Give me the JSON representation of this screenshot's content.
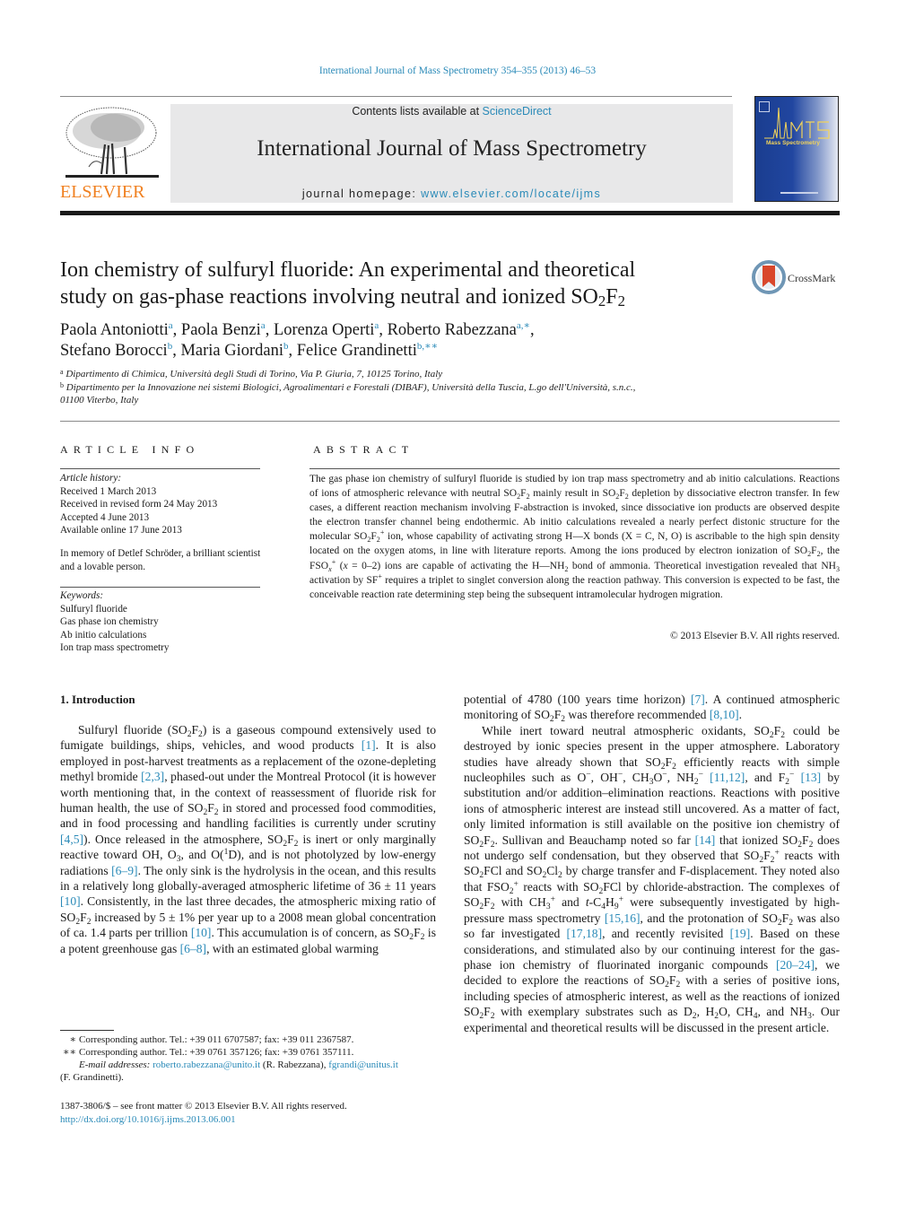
{
  "running_header": "International Journal of Mass Spectrometry 354–355 (2013) 46–53",
  "masthead": {
    "publisher_logo_text": "ELSEVIER",
    "contents_prefix": "Contents lists available at ",
    "contents_link": "ScienceDirect",
    "journal_title": "International Journal of Mass Spectrometry",
    "homepage_prefix": "journal homepage: ",
    "homepage_link": "www.elsevier.com/locate/ijms",
    "cover_title": "Mass Spectrometry",
    "cover_logo_text": "IJMS"
  },
  "article": {
    "title_line1": "Ion chemistry of sulfuryl fluoride: An experimental and theoretical",
    "title_line2_prefix": "study on gas-phase reactions involving neutral and ionized SO",
    "crossmark_label": "CrossMark",
    "authors": [
      {
        "name": "Paola Antoniotti",
        "mark": "a"
      },
      {
        "name": "Paola Benzi",
        "mark": "a"
      },
      {
        "name": "Lorenza Operti",
        "mark": "a"
      },
      {
        "name": "Roberto Rabezzana",
        "mark": "a,∗"
      },
      {
        "name": "Stefano Borocci",
        "mark": "b"
      },
      {
        "name": "Maria Giordani",
        "mark": "b"
      },
      {
        "name": "Felice Grandinetti",
        "mark": "b,∗∗"
      }
    ],
    "affiliations": [
      {
        "mark": "a",
        "text": "Dipartimento di Chimica, Università degli Studi di Torino, Via P. Giuria, 7, 10125 Torino, Italy"
      },
      {
        "mark": "b",
        "text_line1": "Dipartimento per la Innovazione nei sistemi Biologici, Agroalimentari e Forestali (DIBAF), Università della Tuscia, L.go dell'Università, s.n.c.,",
        "text_line2": "01100 Viterbo, Italy"
      }
    ]
  },
  "article_info": {
    "heading": "ARTICLE INFO",
    "history_label": "Article history:",
    "history": [
      "Received 1 March 2013",
      "Received in revised form 24 May 2013",
      "Accepted 4 June 2013",
      "Available online 17 June 2013"
    ],
    "dedication": "In memory of Detlef Schröder, a brilliant scientist and a lovable person.",
    "keywords_label": "Keywords:",
    "keywords": [
      "Sulfuryl fluoride",
      "Gas phase ion chemistry",
      "Ab initio calculations",
      "Ion trap mass spectrometry"
    ]
  },
  "abstract": {
    "heading": "ABSTRACT",
    "copyright": "© 2013 Elsevier B.V. All rights reserved."
  },
  "introduction": {
    "heading": "1.  Introduction"
  },
  "footnotes": {
    "fn1_mark": "∗",
    "fn1_text": "Corresponding author. Tel.: +39 011 6707587; fax: +39 011 2367587.",
    "fn2_mark": "∗∗",
    "fn2_text": "Corresponding author. Tel.: +39 0761 357126; fax: +39 0761 357111.",
    "email_label": "E-mail addresses:",
    "email1": "roberto.rabezzana@unito.it",
    "email1_name": " (R. Rabezzana), ",
    "email2": "fgrandi@unitus.it",
    "email2_name": "(F. Grandinetti).",
    "issn_line": "1387-3806/$ – see front matter © 2013 Elsevier B.V. All rights reserved.",
    "doi": "http://dx.doi.org/10.1016/j.ijms.2013.06.001"
  },
  "colors": {
    "link": "#2a8ab8",
    "elsevier_orange": "#f08020",
    "band_gray": "#e8e8e9"
  }
}
